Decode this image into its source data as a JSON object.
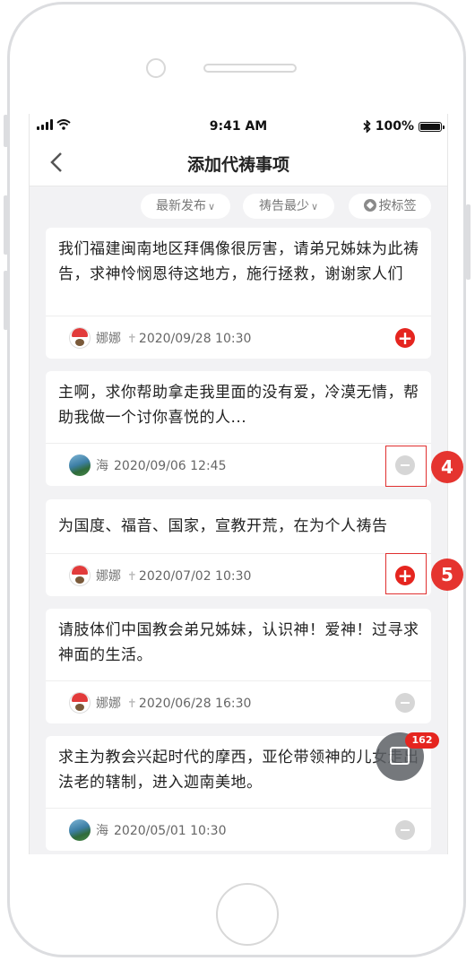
{
  "statusbar": {
    "time": "9:41 AM",
    "battery": "100%"
  },
  "navbar": {
    "back_icon": "chevron-left-icon",
    "title": "添加代祷事项"
  },
  "filters": {
    "latest": "最新发布",
    "least_prayed": "祷告最少",
    "by_tag": "按标签"
  },
  "cards": [
    {
      "text": "我们福建闽南地区拜偶像很厉害，请弟兄姊妹为此祷告，求神怜悯恩待这地方，施行拯救，谢谢家人们",
      "name": "娜娜",
      "date": "2020/09/28 10:30",
      "action": "add"
    },
    {
      "text": "主啊，求你帮助拿走我里面的没有爱，冷漠无情，帮助我做一个讨你喜悦的人...",
      "name": "海",
      "date": "2020/09/06 12:45",
      "action": "remove"
    },
    {
      "text": "为国度、福音、国家，宣教开荒，在为个人祷告",
      "name": "娜娜",
      "date": "2020/07/02 10:30",
      "action": "add"
    },
    {
      "text": "请肢体们中国教会弟兄姊妹，认识神！爱神！过寻求神面的生活。",
      "name": "娜娜",
      "date": "2020/06/28 16:30",
      "action": "remove"
    },
    {
      "text": "求主为教会兴起时代的摩西，亚伦带领神的儿女走出法老的辖制，进入迦南美地。",
      "name": "海",
      "date": "2020/05/01 10:30",
      "action": "remove"
    }
  ],
  "annotations": {
    "four": "4",
    "five": "5"
  },
  "fab": {
    "count": "162"
  },
  "colors": {
    "accent_red": "#e5251f",
    "background": "#f2f2f4"
  }
}
